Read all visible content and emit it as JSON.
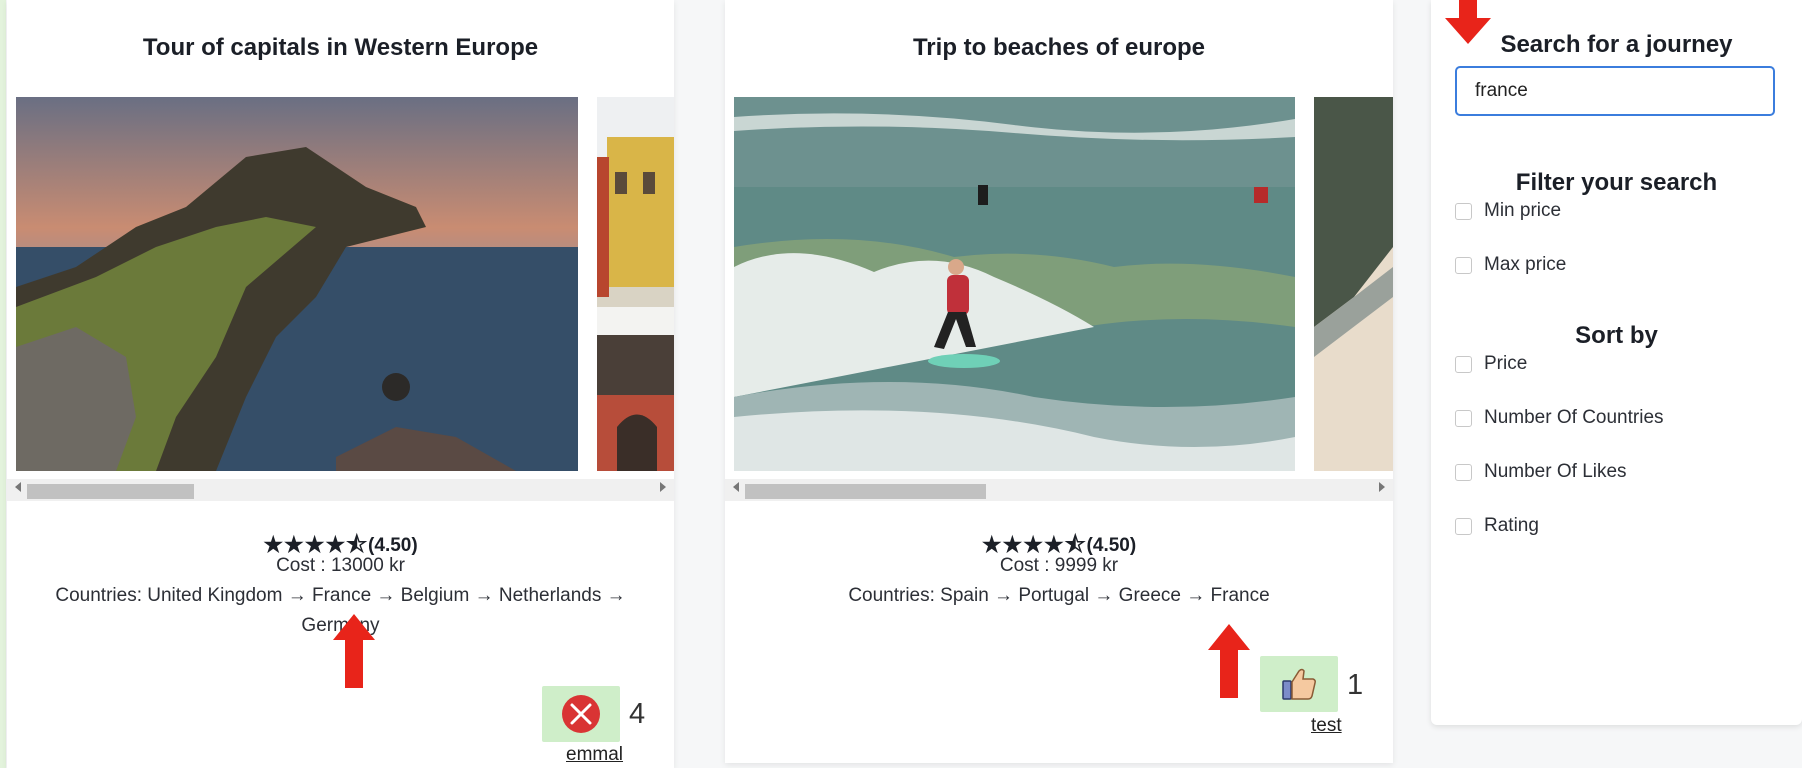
{
  "cards": [
    {
      "title": "Tour of capitals in Western Europe",
      "rating_text": "(4.50)",
      "stars": "★★★★⯪",
      "cost": "Cost : 13000 kr",
      "countries": "Countries: United Kingdom → France → Belgium → Netherlands → Germany",
      "like_count": "4",
      "like_icon": "close-circle-icon",
      "user": "emmal"
    },
    {
      "title": "Trip to beaches of europe",
      "rating_text": "(4.50)",
      "stars": "★★★★⯪",
      "cost": "Cost : 9999 kr",
      "countries": "Countries: Spain → Portugal → Greece → France",
      "like_count": "1",
      "like_icon": "thumbs-up-icon",
      "user": "test"
    }
  ],
  "sidebar": {
    "search_heading": "Search for a journey",
    "search_value": "france",
    "filter_heading": "Filter your search",
    "filter_options": [
      "Min price",
      "Max price"
    ],
    "sort_heading": "Sort by",
    "sort_options": [
      "Price",
      "Number Of Countries",
      "Number Of Likes",
      "Rating"
    ]
  },
  "colors": {
    "annotation_arrow": "#e8241a",
    "like_button_bg": "#cfeec9",
    "input_border": "#3b7ddd"
  }
}
